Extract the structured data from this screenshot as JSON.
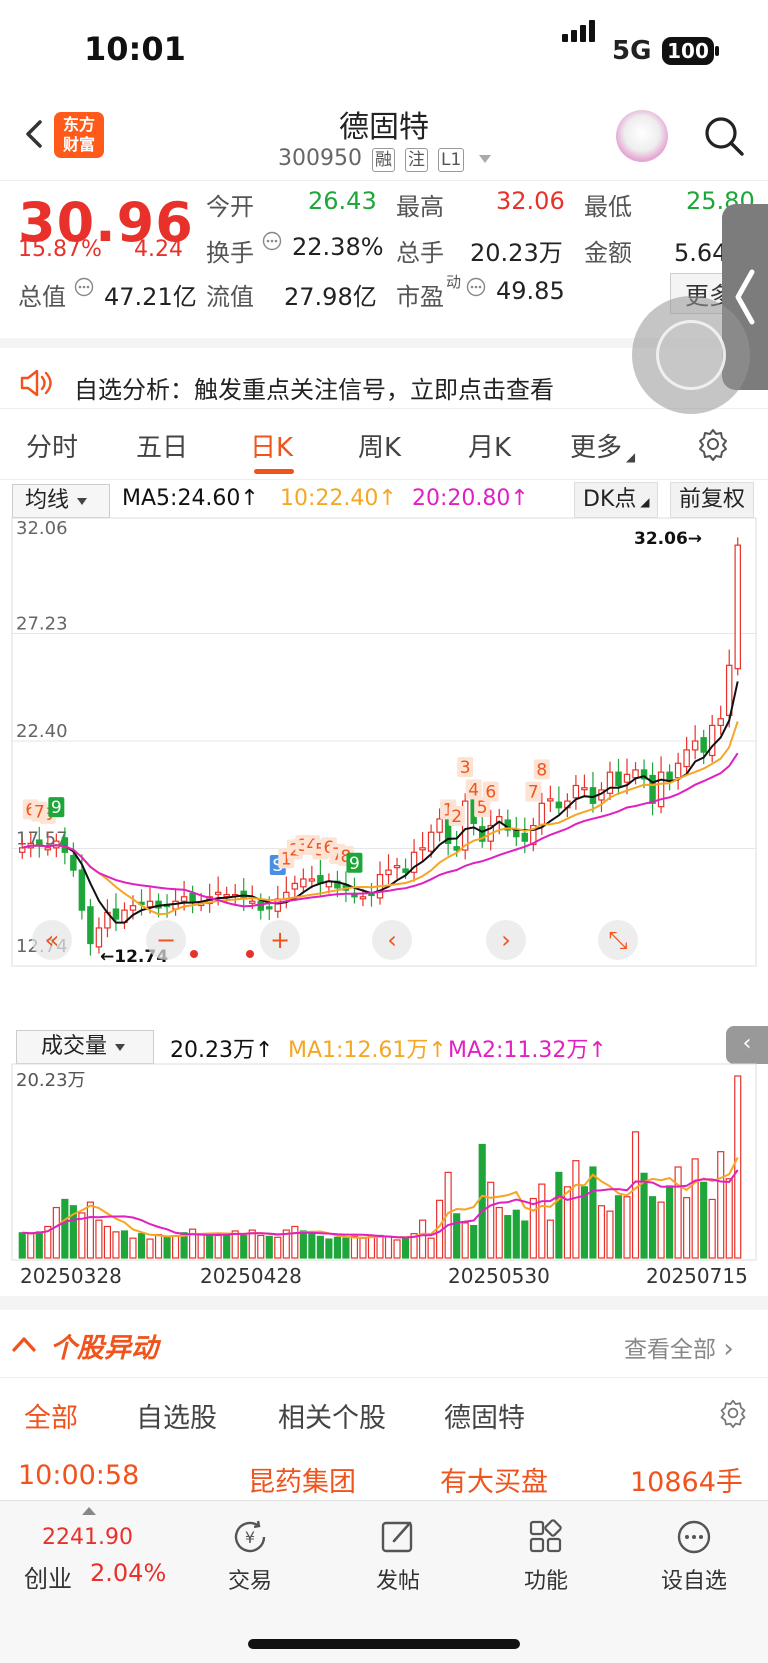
{
  "status": {
    "time": "10:01",
    "network": "5G",
    "battery": "100"
  },
  "header": {
    "name": "德固特",
    "code": "300950",
    "tags": [
      "融",
      "注",
      "L1"
    ],
    "logo_lines": [
      "东方",
      "财富"
    ]
  },
  "quote": {
    "price": "30.96",
    "change_pct": "15.87%",
    "change": "4.24",
    "rows": [
      [
        {
          "label": "今开",
          "value": "26.43",
          "color": "green"
        },
        {
          "label": "最高",
          "value": "32.06",
          "color": "red"
        },
        {
          "label": "最低",
          "value": "25.80",
          "color": "green"
        }
      ],
      [
        {
          "label": "换手",
          "value": "22.38%",
          "color": "gray"
        },
        {
          "label": "总手",
          "value": "20.23万",
          "color": "gray"
        },
        {
          "label": "金额",
          "value": "5.64亿",
          "color": "gray"
        }
      ],
      [
        {
          "label": "总值",
          "value": "47.21亿",
          "color": "gray"
        },
        {
          "label": "流值",
          "value": "27.98亿",
          "color": "gray"
        },
        {
          "label": "市盈",
          "sup": "动",
          "value": "49.85",
          "color": "gray"
        }
      ]
    ],
    "more_label": "更多"
  },
  "alert": {
    "text": "自选分析：触发重点关注信号，立即点击查看"
  },
  "tabs": [
    "分时",
    "五日",
    "日K",
    "周K",
    "月K",
    "更多"
  ],
  "active_tab": "日K",
  "ma_bar": {
    "selector": "均线",
    "ma5": "MA5:24.60↑",
    "ma10": "10:22.40↑",
    "ma20": "20:20.80↑",
    "dk_btn": "DK点",
    "fq_btn": "前复权",
    "colors": {
      "ma5": "#111111",
      "ma10": "#f5a623",
      "ma20": "#e020c0"
    }
  },
  "chart_data": [
    {
      "type": "candlestick",
      "y_ticks": [
        "32.06",
        "27.23",
        "22.40",
        "17.57",
        "12.74"
      ],
      "ylim": [
        12.74,
        32.06
      ],
      "high_label": "32.06→",
      "low_label": "←12.74",
      "closes": [
        17.6,
        17.8,
        17.7,
        17.6,
        17.9,
        17.4,
        16.6,
        14.8,
        13.3,
        14.0,
        14.7,
        14.4,
        14.8,
        15.0,
        15.1,
        15.2,
        14.9,
        15.0,
        15.2,
        15.4,
        15.2,
        15.1,
        15.4,
        15.6,
        15.5,
        15.5,
        15.3,
        15.2,
        14.8,
        14.9,
        15.3,
        15.6,
        16.0,
        16.2,
        16.2,
        16.0,
        16.1,
        15.8,
        15.7,
        15.4,
        15.4,
        15.5,
        16.4,
        16.6,
        16.8,
        16.5,
        17.4,
        17.6,
        18.3,
        18.9,
        17.8,
        17.5,
        19.7,
        18.7,
        17.9,
        18.6,
        19.0,
        18.4,
        18.1,
        17.9,
        18.6,
        19.6,
        19.8,
        19.4,
        19.7,
        20.4,
        20.3,
        19.6,
        20.2,
        21.0,
        20.4,
        20.9,
        21.1,
        20.7,
        19.6,
        21.0,
        20.6,
        21.4,
        22.0,
        22.4,
        21.9,
        23.1,
        23.4,
        25.8,
        31.2
      ],
      "open_offsets_note": "",
      "signals": [
        "6",
        "8",
        "7",
        "9",
        "S",
        "1",
        "2",
        "3",
        "4",
        "5",
        "6",
        "7",
        "8",
        "9",
        "1",
        "2",
        "3",
        "4",
        "5",
        "6",
        "7",
        "8"
      ],
      "ma_series": [
        {
          "name": "MA5"
        },
        {
          "name": "10"
        },
        {
          "name": "20"
        }
      ]
    },
    {
      "type": "bar",
      "title": "成交量",
      "current": "20.23万↑",
      "ma1": "MA1:12.61万↑",
      "ma2": "MA2:11.32万↑",
      "max_label": "20.23万",
      "x_dates": [
        "20250328",
        "20250428",
        "20250530",
        "20250715"
      ],
      "volumes": [
        2.8,
        2.7,
        2.9,
        3.5,
        5.6,
        6.5,
        5.8,
        5.0,
        6.2,
        4.2,
        3.5,
        2.9,
        3.0,
        2.2,
        2.7,
        2.1,
        2.6,
        2.4,
        2.4,
        2.8,
        3.2,
        2.6,
        2.6,
        2.5,
        2.7,
        3.0,
        2.5,
        3.1,
        2.5,
        2.4,
        2.3,
        3.1,
        3.5,
        3.0,
        2.7,
        2.4,
        2.1,
        2.3,
        2.2,
        2.4,
        2.2,
        2.5,
        2.5,
        2.4,
        2.0,
        2.2,
        2.7,
        4.2,
        2.2,
        6.4,
        9.5,
        4.9,
        3.9,
        3.6,
        12.6,
        8.4,
        5.6,
        4.7,
        5.3,
        4.1,
        6.6,
        8.2,
        4.2,
        9.5,
        7.9,
        10.8,
        7.9,
        10.1,
        5.8,
        5.2,
        6.9,
        6.8,
        14.0,
        9.4,
        6.8,
        6.2,
        8.0,
        10.1,
        6.7,
        11.0,
        8.4,
        6.5,
        11.8,
        8.8,
        20.2
      ],
      "up_flags": [
        0,
        1,
        0,
        1,
        1,
        0,
        0,
        1,
        1,
        1,
        1,
        1,
        0,
        1,
        0,
        1,
        1,
        0,
        1,
        0,
        1,
        1,
        0,
        1,
        0,
        1,
        0,
        1,
        1,
        0,
        1,
        1,
        1,
        0,
        0,
        0,
        0,
        0,
        0,
        1,
        1,
        1,
        1,
        1,
        1,
        0,
        1,
        1,
        1,
        1,
        1,
        0,
        1,
        0,
        0,
        1,
        1,
        0,
        0,
        0,
        1,
        1,
        1,
        0,
        1,
        1,
        0,
        0,
        1,
        1,
        0,
        1,
        1,
        0,
        0,
        1,
        0,
        1,
        1,
        1,
        0,
        1,
        1,
        1,
        1
      ]
    }
  ],
  "vol_bar": {
    "selector": "成交量"
  },
  "section": {
    "title": "个股异动",
    "more": "查看全部"
  },
  "subtabs": [
    "全部",
    "自选股",
    "相关个股",
    "德固特"
  ],
  "row": {
    "time": "10:00:58",
    "stock": "昆药集团",
    "event": "有大买盘",
    "qty": "10864手"
  },
  "bottom": {
    "index_value": "2241.90",
    "index_name": "创业",
    "index_pct": "2.04%",
    "nav": [
      "交易",
      "发帖",
      "功能",
      "设自选"
    ]
  }
}
